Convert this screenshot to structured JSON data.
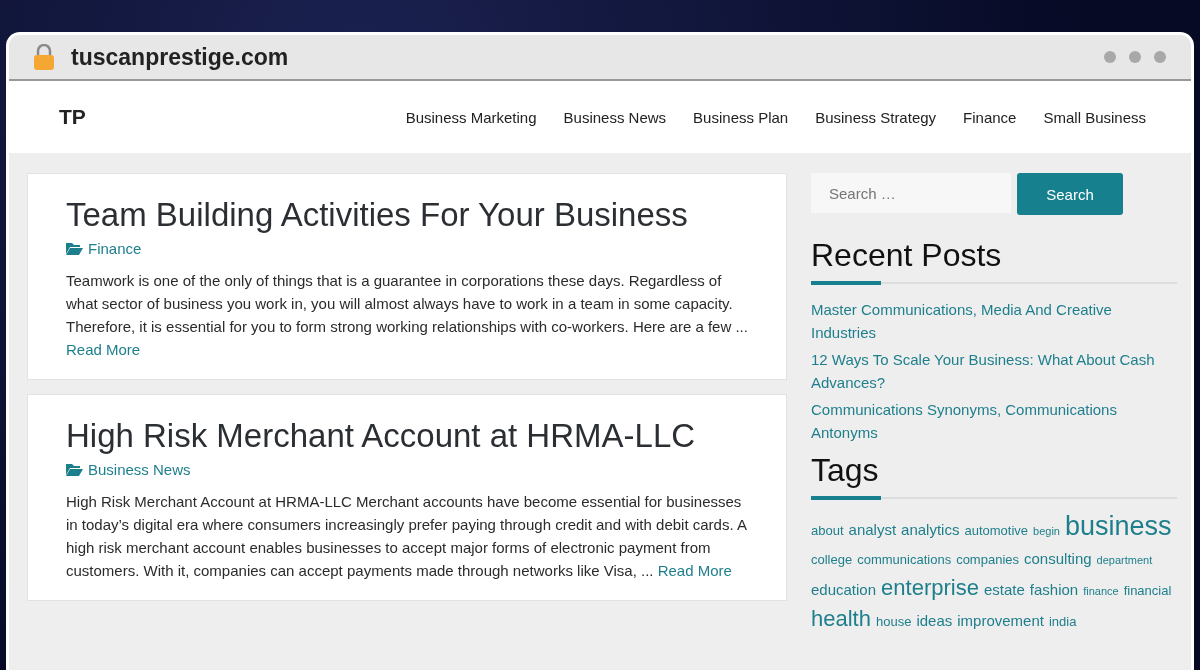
{
  "browser": {
    "address": "tuscanprestige.com"
  },
  "site": {
    "logo": "TP",
    "nav": [
      {
        "label": "Business Marketing"
      },
      {
        "label": "Business News"
      },
      {
        "label": "Business Plan"
      },
      {
        "label": "Business Strategy"
      },
      {
        "label": "Finance"
      },
      {
        "label": "Small Business"
      }
    ]
  },
  "posts": [
    {
      "title": "Team Building Activities For Your Business",
      "category": "Finance",
      "excerpt": "Teamwork is one of the only of things that is a guarantee in corporations these days. Regardless of what sector of business you work in, you will almost always have to work in a team in some capacity. Therefore, it is essential for you to form strong working relationships with co-workers. Here are a few ...",
      "read_more": "Read More"
    },
    {
      "title": "High Risk Merchant Account at HRMA-LLC",
      "category": "Business News",
      "excerpt": "High Risk Merchant Account at HRMA-LLC Merchant accounts have become essential for businesses in today’s digital era where consumers increasingly prefer paying through credit and with debit cards. A high risk merchant account enables businesses to accept major forms of electronic payment from customers. With it, companies can accept payments made through networks like Visa, ...",
      "read_more": "Read More"
    }
  ],
  "sidebar": {
    "search": {
      "placeholder": "Search …",
      "button": "Search"
    },
    "recent_posts": {
      "title": "Recent Posts",
      "items": [
        "Master Communications, Media And Creative Industries",
        "12 Ways To Scale Your Business: What About Cash Advances?",
        "Communications Synonyms, Communications Antonyms"
      ]
    },
    "tags": {
      "title": "Tags",
      "items": [
        {
          "label": "about",
          "kind": "small"
        },
        {
          "label": "analyst",
          "kind": "medium"
        },
        {
          "label": "analytics",
          "kind": "medium"
        },
        {
          "label": "automotive",
          "kind": "small"
        },
        {
          "label": "begin",
          "kind": "tiny"
        },
        {
          "label": "business",
          "kind": "huge"
        },
        {
          "label": "college",
          "kind": "small"
        },
        {
          "label": "communications",
          "kind": "small"
        },
        {
          "label": "companies",
          "kind": "small"
        },
        {
          "label": "consulting",
          "kind": "medium"
        },
        {
          "label": "department",
          "kind": "tiny"
        },
        {
          "label": "education",
          "kind": "medium"
        },
        {
          "label": "enterprise",
          "kind": "large"
        },
        {
          "label": "estate",
          "kind": "medium"
        },
        {
          "label": "fashion",
          "kind": "medium"
        },
        {
          "label": "finance",
          "kind": "tiny"
        },
        {
          "label": "financial",
          "kind": "small"
        },
        {
          "label": "health",
          "kind": "large"
        },
        {
          "label": "house",
          "kind": "small"
        },
        {
          "label": "ideas",
          "kind": "medium"
        },
        {
          "label": "improvement",
          "kind": "medium"
        },
        {
          "label": "india",
          "kind": "small"
        }
      ]
    }
  }
}
